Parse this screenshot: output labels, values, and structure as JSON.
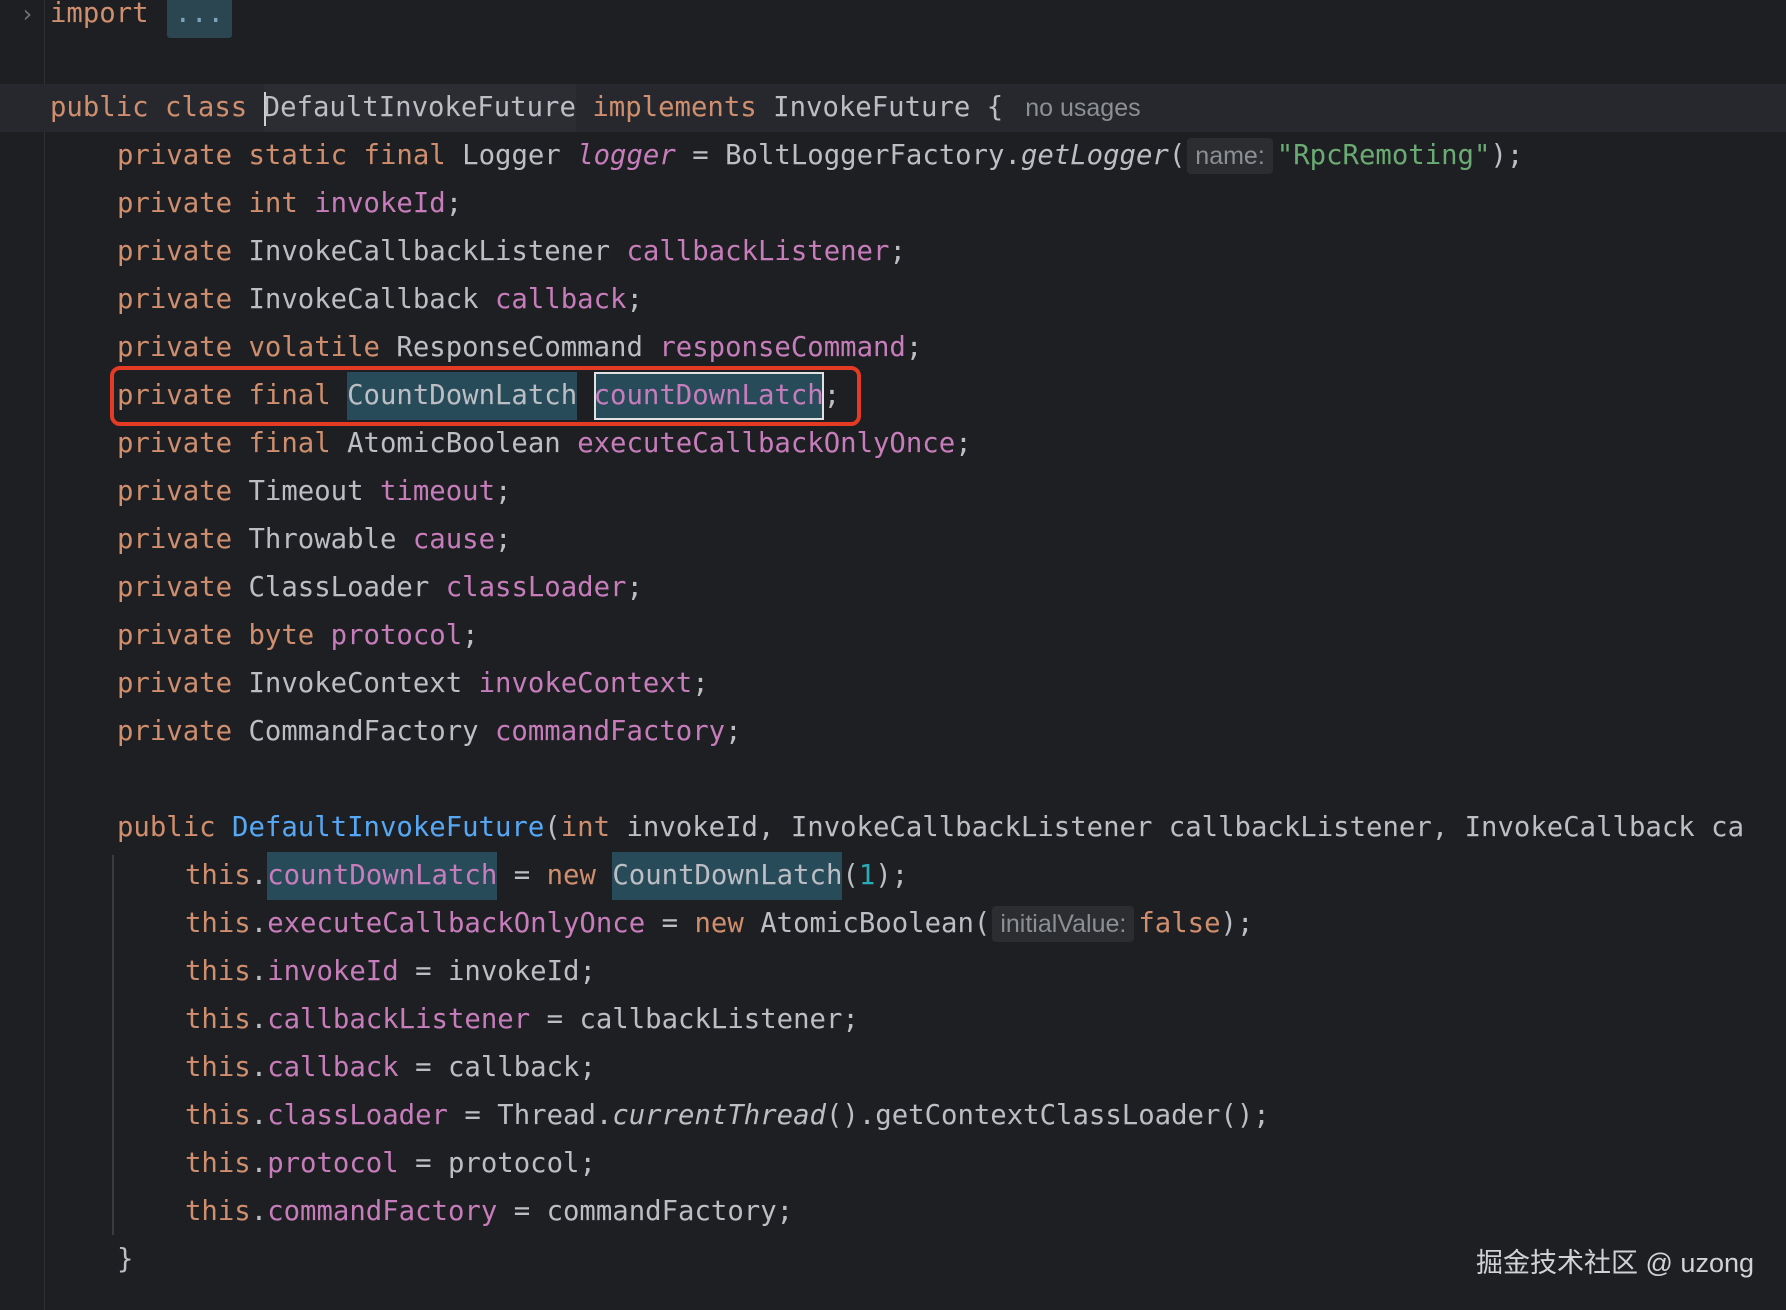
{
  "editor": {
    "import_line": {
      "keyword": "import",
      "folded": "..."
    },
    "class_decl": {
      "public": "public",
      "class": "class",
      "name_first": "D",
      "name_rest": "efaultInvokeFuture",
      "implements": "implements",
      "iface": "InvokeFuture",
      "brace": " {",
      "usages": "no usages"
    },
    "fields": {
      "l1": {
        "p": "private",
        "s": "static",
        "f": "final",
        "t": "Logger",
        "n": "logger",
        "eq": " = ",
        "call_obj": "BoltLoggerFactory.",
        "call_fn": "getLogger",
        "open": "(",
        "hint": "name:",
        "arg": "\"RpcRemoting\"",
        "close": ");"
      },
      "l2": {
        "p": "private",
        "t": "int",
        "n": "invokeId",
        "end": ";"
      },
      "l3": {
        "p": "private",
        "t": "InvokeCallbackListener",
        "n": "callbackListener",
        "end": ";"
      },
      "l4": {
        "p": "private",
        "t": "InvokeCallback",
        "n": "callback",
        "end": ";"
      },
      "l5": {
        "p": "private",
        "m": "volatile",
        "t": "ResponseCommand",
        "n": "responseCommand",
        "end": ";"
      },
      "l6": {
        "p": "private",
        "m": "final",
        "t": "CountDownLatch",
        "n": "countDownLatch",
        "end": ";"
      },
      "l7": {
        "p": "private",
        "m": "final",
        "t": "AtomicBoolean",
        "n": "executeCallbackOnlyOnce",
        "end": ";"
      },
      "l8": {
        "p": "private",
        "t": "Timeout",
        "n": "timeout",
        "end": ";"
      },
      "l9": {
        "p": "private",
        "t": "Throwable",
        "n": "cause",
        "end": ";"
      },
      "l10": {
        "p": "private",
        "t": "ClassLoader",
        "n": "classLoader",
        "end": ";"
      },
      "l11": {
        "p": "private",
        "t": "byte",
        "n": "protocol",
        "end": ";"
      },
      "l12": {
        "p": "private",
        "t": "InvokeContext",
        "n": "invokeContext",
        "end": ";"
      },
      "l13": {
        "p": "private",
        "t": "CommandFactory",
        "n": "commandFactory",
        "end": ";"
      }
    },
    "ctor": {
      "public": "public",
      "name": "DefaultInvokeFuture",
      "params_a": "(",
      "int": "int",
      "params_b": " invokeId, InvokeCallbackListener callbackListener, InvokeCallback ca"
    },
    "body": {
      "b1": {
        "this": "this",
        "dot": ".",
        "f": "countDownLatch",
        "eq": " = ",
        "new": "new",
        "t": "CountDownLatch",
        "open": "(",
        "num": "1",
        "close": ");"
      },
      "b2": {
        "this": "this",
        "dot": ".",
        "f": "executeCallbackOnlyOnce",
        "eq": " = ",
        "new": "new",
        "t": "AtomicBoolean(",
        "hint": "initialValue:",
        "val": "false",
        "close": ");"
      },
      "b3": {
        "this": "this",
        "dot": ".",
        "f": "invokeId",
        "rest": " = invokeId;"
      },
      "b4": {
        "this": "this",
        "dot": ".",
        "f": "callbackListener",
        "rest": " = callbackListener;"
      },
      "b5": {
        "this": "this",
        "dot": ".",
        "f": "callback",
        "rest": " = callback;"
      },
      "b6": {
        "this": "this",
        "dot": ".",
        "f": "classLoader",
        "eq": " = Thread.",
        "call": "currentThread",
        "rest": "().getContextClassLoader();"
      },
      "b7": {
        "this": "this",
        "dot": ".",
        "f": "protocol",
        "rest": " = protocol;"
      },
      "b8": {
        "this": "this",
        "dot": ".",
        "f": "commandFactory",
        "rest": " = commandFactory;"
      },
      "close": "}"
    }
  },
  "watermark": "掘金技术社区 @ uzong"
}
